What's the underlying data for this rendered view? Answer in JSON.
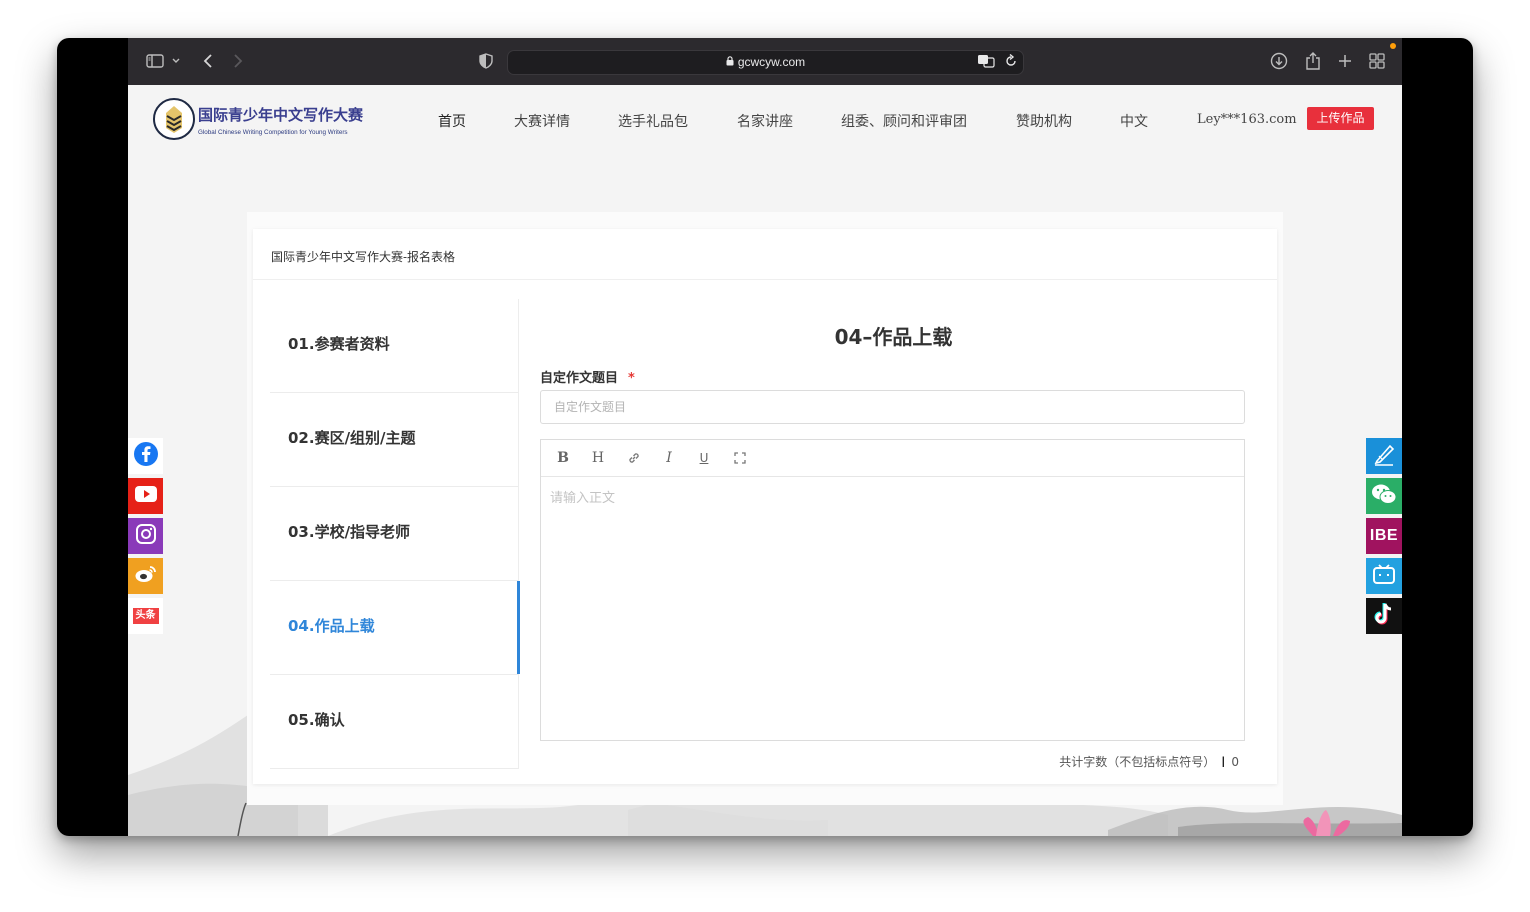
{
  "browser": {
    "url": "gcwcyw.com"
  },
  "site": {
    "logo_title": "国际青少年中文写作大赛",
    "logo_subtitle": "Global Chinese Writing Competition for Young Writers",
    "nav": [
      {
        "label": "首页"
      },
      {
        "label": "大赛详情"
      },
      {
        "label": "选手礼品包"
      },
      {
        "label": "名家讲座"
      },
      {
        "label": "组委、顾问和评审团"
      },
      {
        "label": "赞助机构"
      },
      {
        "label": "中文"
      },
      {
        "label": "Ley***163.com"
      }
    ],
    "upload_label": "上传作品"
  },
  "form_page": {
    "breadcrumb": "国际青少年中文写作大赛-报名表格",
    "steps": [
      {
        "label": "01.参赛者资料"
      },
      {
        "label": "02.赛区/组别/主题"
      },
      {
        "label": "03.学校/指导老师"
      },
      {
        "label": "04.作品上载"
      },
      {
        "label": "05.确认"
      }
    ],
    "active_step": 4,
    "heading": "04–作品上载",
    "title_field": {
      "label": "自定作文题目",
      "required_mark": "*",
      "placeholder": "自定作文题目",
      "value": ""
    },
    "editor": {
      "toolbar": [
        {
          "icon": "bold-icon",
          "glyph": "B"
        },
        {
          "icon": "heading-icon",
          "glyph": "H"
        },
        {
          "icon": "link-icon"
        },
        {
          "icon": "italic-icon",
          "glyph": "I"
        },
        {
          "icon": "underline-icon",
          "glyph": "U"
        },
        {
          "icon": "fullscreen-icon"
        }
      ],
      "placeholder": "请输入正文",
      "value": ""
    },
    "word_count_label": "共计字数（不包括标点符号）",
    "word_count_value": "0"
  },
  "social_left": [
    {
      "icon": "facebook-icon",
      "color": "#1877f2"
    },
    {
      "icon": "youtube-icon",
      "color": "#e62117"
    },
    {
      "icon": "instagram-icon",
      "color": "#8a3ab9"
    },
    {
      "icon": "weibo-icon",
      "color": "#f0a020"
    },
    {
      "icon": "toutiao-icon",
      "color": "#f04142",
      "text": "头条"
    }
  ],
  "social_right": [
    {
      "icon": "pen-icon",
      "color": "#1a90d9"
    },
    {
      "icon": "wechat-icon",
      "color": "#2aae67"
    },
    {
      "icon": "ibe-icon",
      "color": "#a0135f",
      "text": "IBE"
    },
    {
      "icon": "bilibili-icon",
      "color": "#23a1e0"
    },
    {
      "icon": "tiktok-icon",
      "color": "#111111"
    }
  ],
  "colors": {
    "accent": "#2f86d9",
    "upload_button": "#e8303c",
    "required": "#e53935"
  }
}
